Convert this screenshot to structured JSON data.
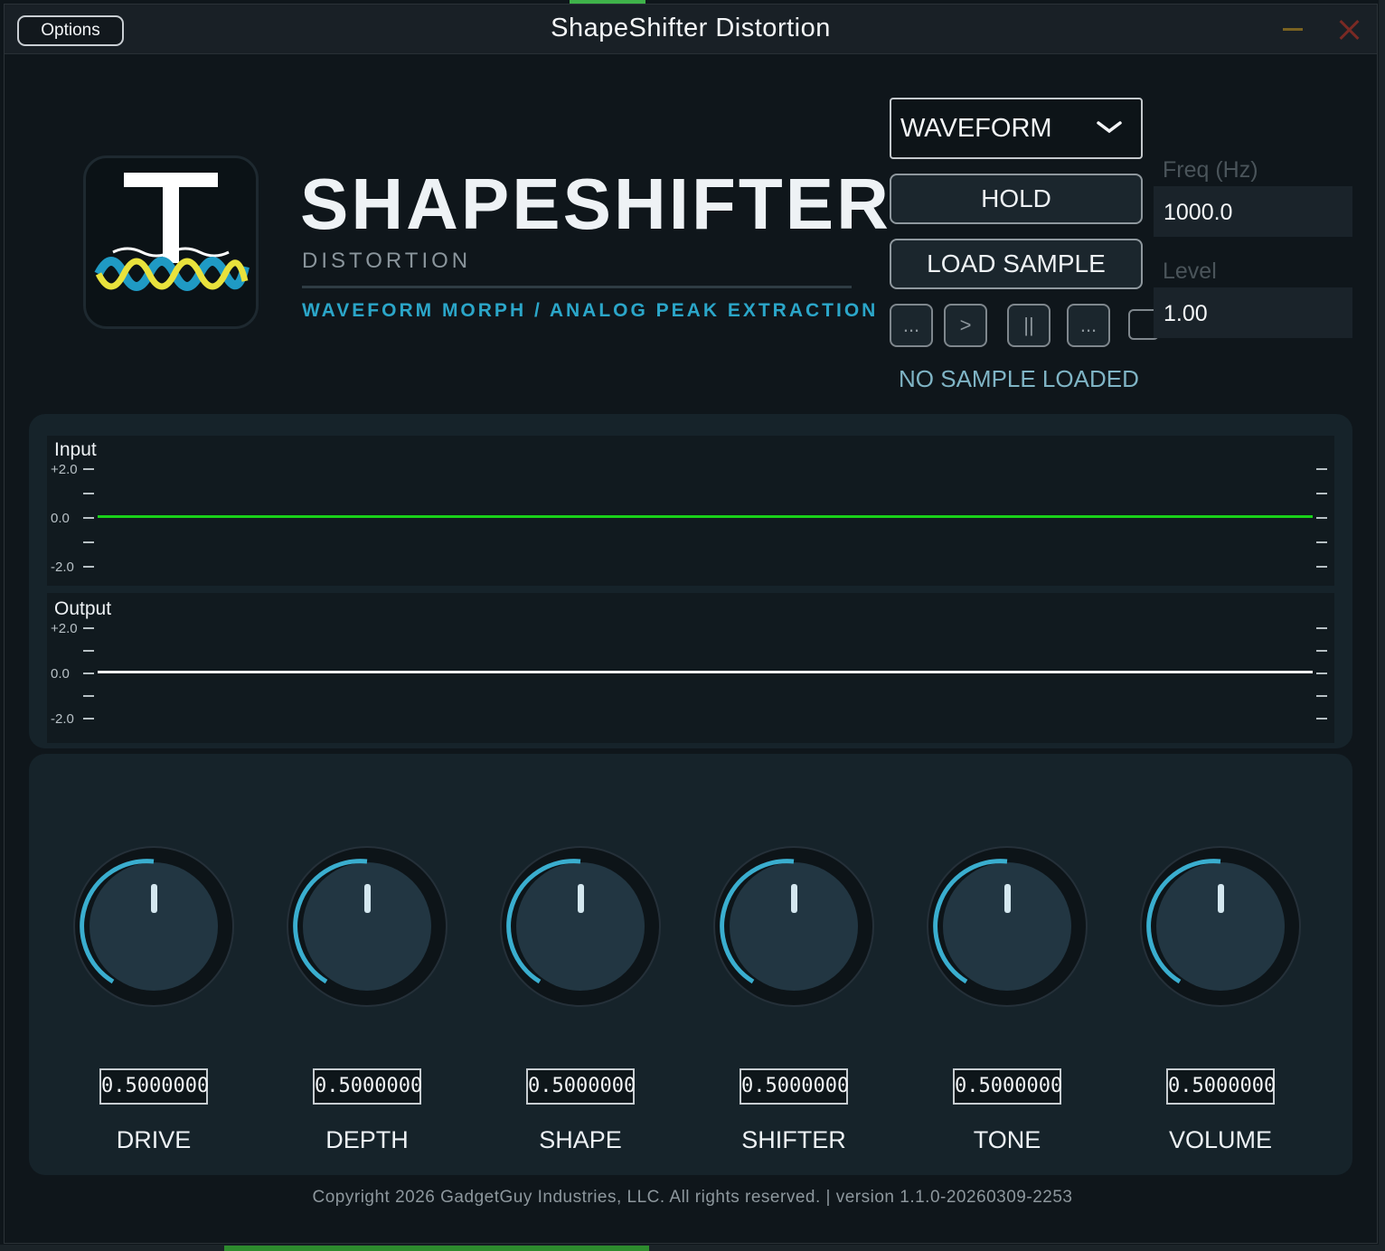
{
  "window": {
    "title": "ShapeShifter Distortion",
    "options_label": "Options"
  },
  "brand": {
    "title": "SHAPESHIFTER",
    "subtitle": "DISTORTION",
    "tagline": "WAVEFORM MORPH / ANALOG PEAK EXTRACTION"
  },
  "controls": {
    "source_select": "WAVEFORM",
    "hold_label": "HOLD",
    "load_label": "LOAD SAMPLE",
    "transport": [
      "...",
      ">",
      "||",
      "..."
    ],
    "status": "NO SAMPLE LOADED",
    "freq_label": "Freq (Hz)",
    "freq_value": "1000.0",
    "level_label": "Level",
    "level_value": "1.00"
  },
  "scopes": {
    "input": {
      "title": "Input",
      "max": "+2.0",
      "mid": "0.0",
      "min": "-2.0",
      "trace_color": "#19d119"
    },
    "output": {
      "title": "Output",
      "max": "+2.0",
      "mid": "0.0",
      "min": "-2.0",
      "trace_color": "#f0f0f0"
    }
  },
  "knobs": [
    {
      "label": "DRIVE",
      "value": "0.5000000"
    },
    {
      "label": "DEPTH",
      "value": "0.5000000"
    },
    {
      "label": "SHAPE",
      "value": "0.5000000"
    },
    {
      "label": "SHIFTER",
      "value": "0.5000000"
    },
    {
      "label": "TONE",
      "value": "0.5000000"
    },
    {
      "label": "VOLUME",
      "value": "0.5000000"
    }
  ],
  "colors": {
    "accent": "#2ba6c9",
    "knob_arc": "#3aaecf"
  },
  "footer": "Copyright 2026 GadgetGuy Industries, LLC. All rights reserved. | version 1.1.0-20260309-2253"
}
